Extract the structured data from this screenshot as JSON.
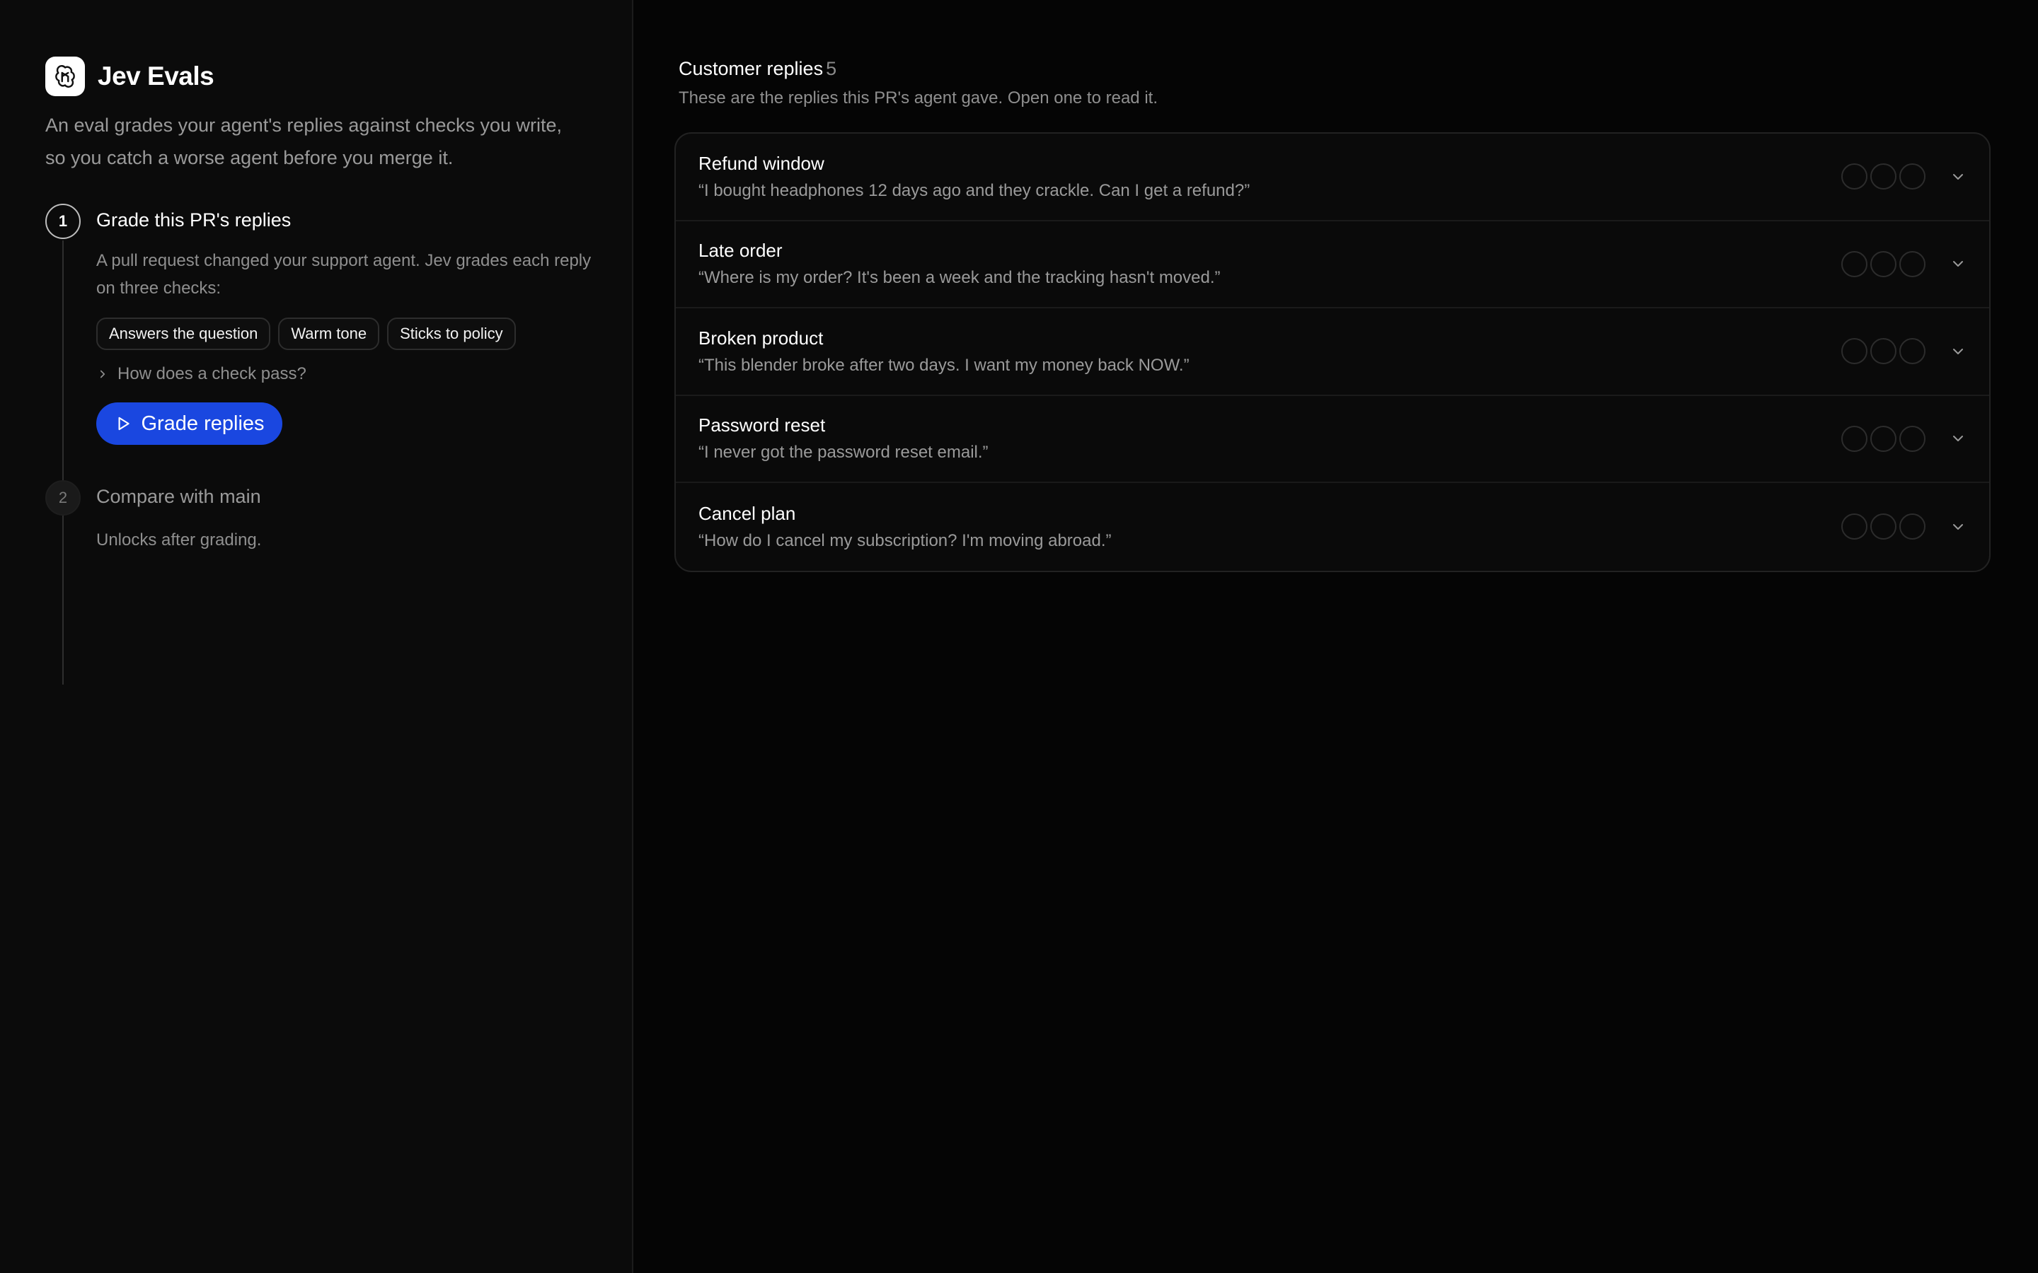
{
  "brand": {
    "name": "Jev Evals"
  },
  "intro": "An eval grades your agent's replies against checks you write, so you catch a worse agent before you merge it.",
  "steps": [
    {
      "number": "1",
      "title": "Grade this PR's replies",
      "description": "A pull request changed your support agent. Jev grades each reply on three checks:",
      "checks": [
        "Answers the question",
        "Warm tone",
        "Sticks to policy"
      ],
      "disclosure": "How does a check pass?",
      "action": "Grade replies"
    },
    {
      "number": "2",
      "title": "Compare with main",
      "description": "Unlocks after grading."
    }
  ],
  "replies": {
    "title": "Customer replies",
    "count": "5",
    "subtitle": "These are the replies this PR's agent gave. Open one to read it.",
    "items": [
      {
        "title": "Refund window",
        "quote": "“I bought headphones 12 days ago and they crackle. Can I get a refund?”"
      },
      {
        "title": "Late order",
        "quote": "“Where is my order? It's been a week and the tracking hasn't moved.”"
      },
      {
        "title": "Broken product",
        "quote": "“This blender broke after two days. I want my money back NOW.”"
      },
      {
        "title": "Password reset",
        "quote": "“I never got the password reset email.”"
      },
      {
        "title": "Cancel plan",
        "quote": "“How do I cancel my subscription? I'm moving abroad.”"
      }
    ]
  },
  "icons": {
    "logo": "openai-knot-icon",
    "play": "play-icon",
    "disclosure": "chevron-right-icon",
    "expand": "chevron-down-icon",
    "check_status": "empty-circle-icon"
  },
  "colors": {
    "accent": "#1a47e0",
    "background": "#050505",
    "sidebar": "#0b0b0b"
  }
}
